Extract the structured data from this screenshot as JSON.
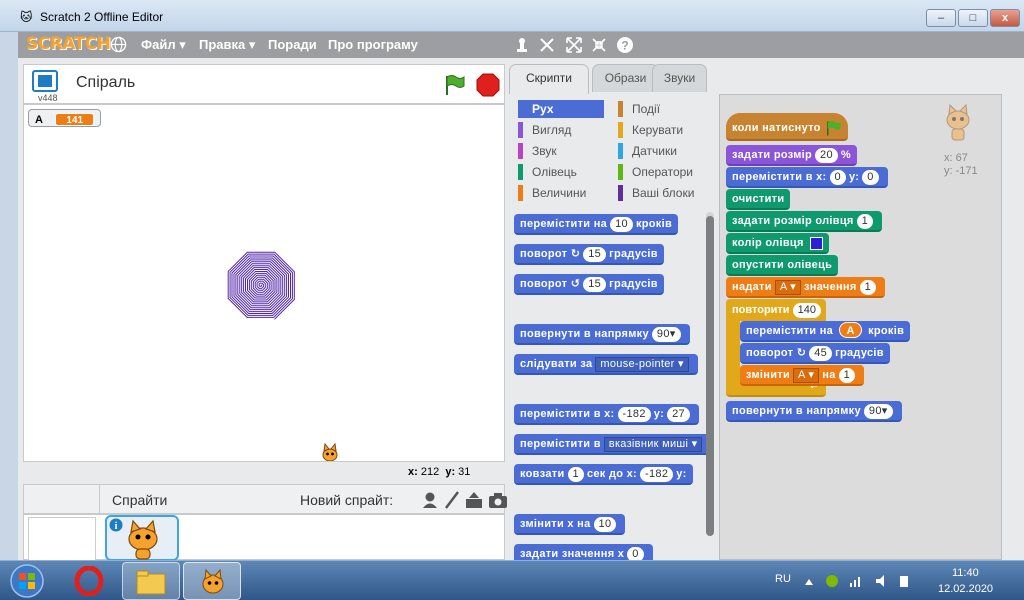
{
  "window": {
    "title": "Scratch 2 Offline Editor",
    "close": "x",
    "minimize": "–",
    "maximize": "□"
  },
  "menubar": {
    "logo": "SCRATCH",
    "file": "Файл ▾",
    "edit": "Правка ▾",
    "tips": "Поради",
    "about": "Про програму"
  },
  "stage": {
    "version": "v448",
    "title": "Спіраль",
    "monitor": {
      "name": "A",
      "value": "141"
    },
    "coords": {
      "x_label": "x:",
      "x": "212",
      "y_label": "y:",
      "y": "31"
    }
  },
  "sprites": {
    "label": "Спрайти",
    "new_sprite": "Новий спрайт:"
  },
  "tabs": {
    "scripts": "Скрипти",
    "costumes": "Образи",
    "sounds": "Звуки"
  },
  "categories": [
    {
      "label": "Рух",
      "color": "#4a6cd4"
    },
    {
      "label": "Вигляд",
      "color": "#8a55d7"
    },
    {
      "label": "Звук",
      "color": "#bb42c3"
    },
    {
      "label": "Олівець",
      "color": "#0e9a6c"
    },
    {
      "label": "Величини",
      "color": "#ee7d16"
    },
    {
      "label": "Події",
      "color": "#c88330"
    },
    {
      "label": "Керувати",
      "color": "#e1a91a"
    },
    {
      "label": "Датчики",
      "color": "#2ca5e2"
    },
    {
      "label": "Оператори",
      "color": "#5cb712"
    },
    {
      "label": "Ваші блоки",
      "color": "#632d99"
    }
  ],
  "palette": {
    "move": {
      "text": "перемістити на",
      "val": "10",
      "suffix": "кроків"
    },
    "turn_right": {
      "text": "поворот",
      "icon": "↻",
      "val": "15",
      "suffix": "градусів"
    },
    "turn_left": {
      "text": "поворот",
      "icon": "↺",
      "val": "15",
      "suffix": "градусів"
    },
    "point_dir": {
      "text": "повернути в напрямку",
      "val": "90▾"
    },
    "point_towards": {
      "text": "слідувати за",
      "val": "mouse-pointer ▾"
    },
    "goto_xy": {
      "text": "перемістити в x:",
      "x": "-182",
      "y_label": "y:",
      "y": "27"
    },
    "goto": {
      "text": "перемістити в",
      "val": "вказівник миші ▾"
    },
    "glide": {
      "text": "ковзати",
      "secs": "1",
      "mid": "сек до x:",
      "x": "-182",
      "y_label": "y:"
    },
    "change_x": {
      "text": "змінити х на",
      "val": "10"
    },
    "set_x": {
      "text": "задати значення х",
      "val": "0"
    }
  },
  "script": {
    "hat": {
      "text": "коли натиснуто"
    },
    "set_size": {
      "text": "задати розмір",
      "val": "20",
      "suffix": "%"
    },
    "goto_xy": {
      "text": "перемістити в х:",
      "x": "0",
      "y_label": "у:",
      "y": "0"
    },
    "clear": {
      "text": "очистити"
    },
    "pen_size": {
      "text": "задати розмір олівця",
      "val": "1"
    },
    "pen_color": {
      "text": "колір олівця",
      "color": "#2a1fd6"
    },
    "pen_down": {
      "text": "опустити олівець"
    },
    "set_var": {
      "text": "надати",
      "var": "A ▾",
      "mid": "значення",
      "val": "1"
    },
    "repeat": {
      "text": "повторити",
      "val": "140"
    },
    "move_a": {
      "text": "перемістити на",
      "var": "A",
      "suffix": "кроків"
    },
    "turn": {
      "text": "поворот",
      "icon": "↻",
      "val": "45",
      "suffix": "градусів"
    },
    "change_var": {
      "text": "змінити",
      "var": "A ▾",
      "mid": "на",
      "val": "1"
    },
    "point_dir": {
      "text": "повернути в напрямку",
      "val": "90▾"
    },
    "readout": {
      "x": "x: 67",
      "y": "y: -171"
    }
  },
  "taskbar": {
    "lang": "RU",
    "time": "11:40",
    "date": "12.02.2020"
  },
  "colors": {
    "motion": "#4a6cd4",
    "looks": "#8a55d7",
    "pen": "#0e9a6c",
    "variables": "#ee7d16",
    "events": "#c88330",
    "control": "#e1a91a",
    "spiral": "#5326a8"
  }
}
